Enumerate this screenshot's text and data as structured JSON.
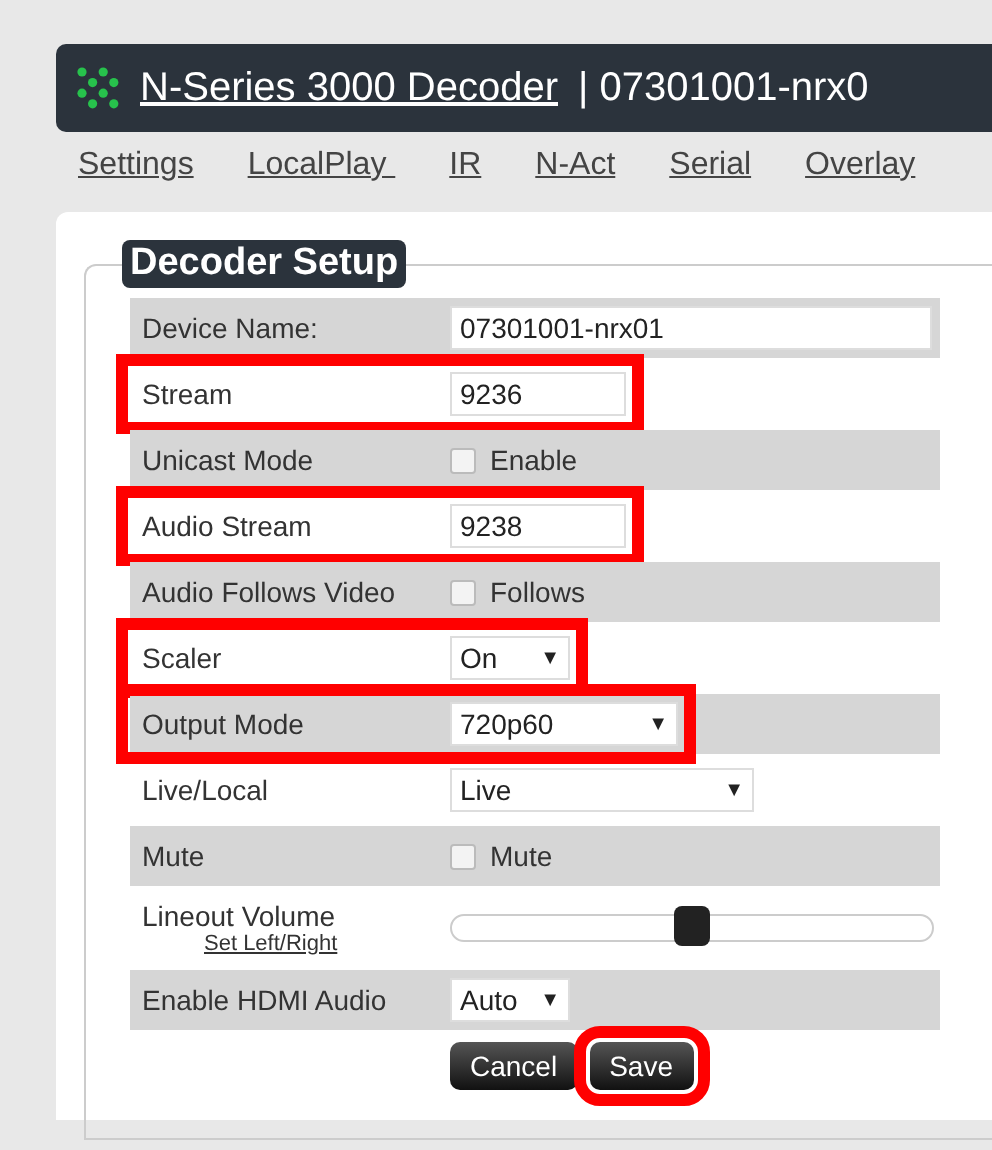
{
  "header": {
    "title_link": "N-Series 3000 Decoder",
    "title_rest": "| 07301001-nrx0"
  },
  "nav": [
    "Settings",
    "LocalPlay ",
    "IR",
    "N-Act",
    "Serial",
    "Overlay"
  ],
  "panel": {
    "legend": "Decoder Setup",
    "rows": [
      {
        "kind": "text",
        "label": "Device Name:",
        "value": "07301001-nrx01",
        "highlighted": false
      },
      {
        "kind": "text",
        "label": "Stream",
        "value": "9236",
        "highlighted": true
      },
      {
        "kind": "checkbox",
        "label": "Unicast Mode",
        "option": "Enable",
        "checked": false,
        "highlighted": false
      },
      {
        "kind": "text",
        "label": "Audio Stream",
        "value": "9238",
        "highlighted": true
      },
      {
        "kind": "checkbox",
        "label": "Audio Follows Video",
        "option": "Follows",
        "checked": false,
        "highlighted": false
      },
      {
        "kind": "select",
        "label": "Scaler",
        "value": "On",
        "caret": "▼",
        "highlighted": true
      },
      {
        "kind": "select",
        "label": "Output Mode",
        "value": "720p60",
        "caret": "▼",
        "highlighted": true
      },
      {
        "kind": "select",
        "label": "Live/Local",
        "value": "Live",
        "caret": "▼",
        "highlighted": false
      },
      {
        "kind": "checkbox",
        "label": "Mute",
        "option": "Mute",
        "checked": false,
        "highlighted": false
      },
      {
        "kind": "slider",
        "label": "Lineout Volume",
        "link": "Set Left/Right",
        "level": 0.5,
        "highlighted": false
      },
      {
        "kind": "select",
        "label": "Enable HDMI Audio",
        "value": "Auto",
        "caret": "▼",
        "highlighted": false
      }
    ],
    "buttons": [
      {
        "label": "Cancel",
        "highlighted": false
      },
      {
        "label": "Save",
        "highlighted": true
      }
    ]
  }
}
